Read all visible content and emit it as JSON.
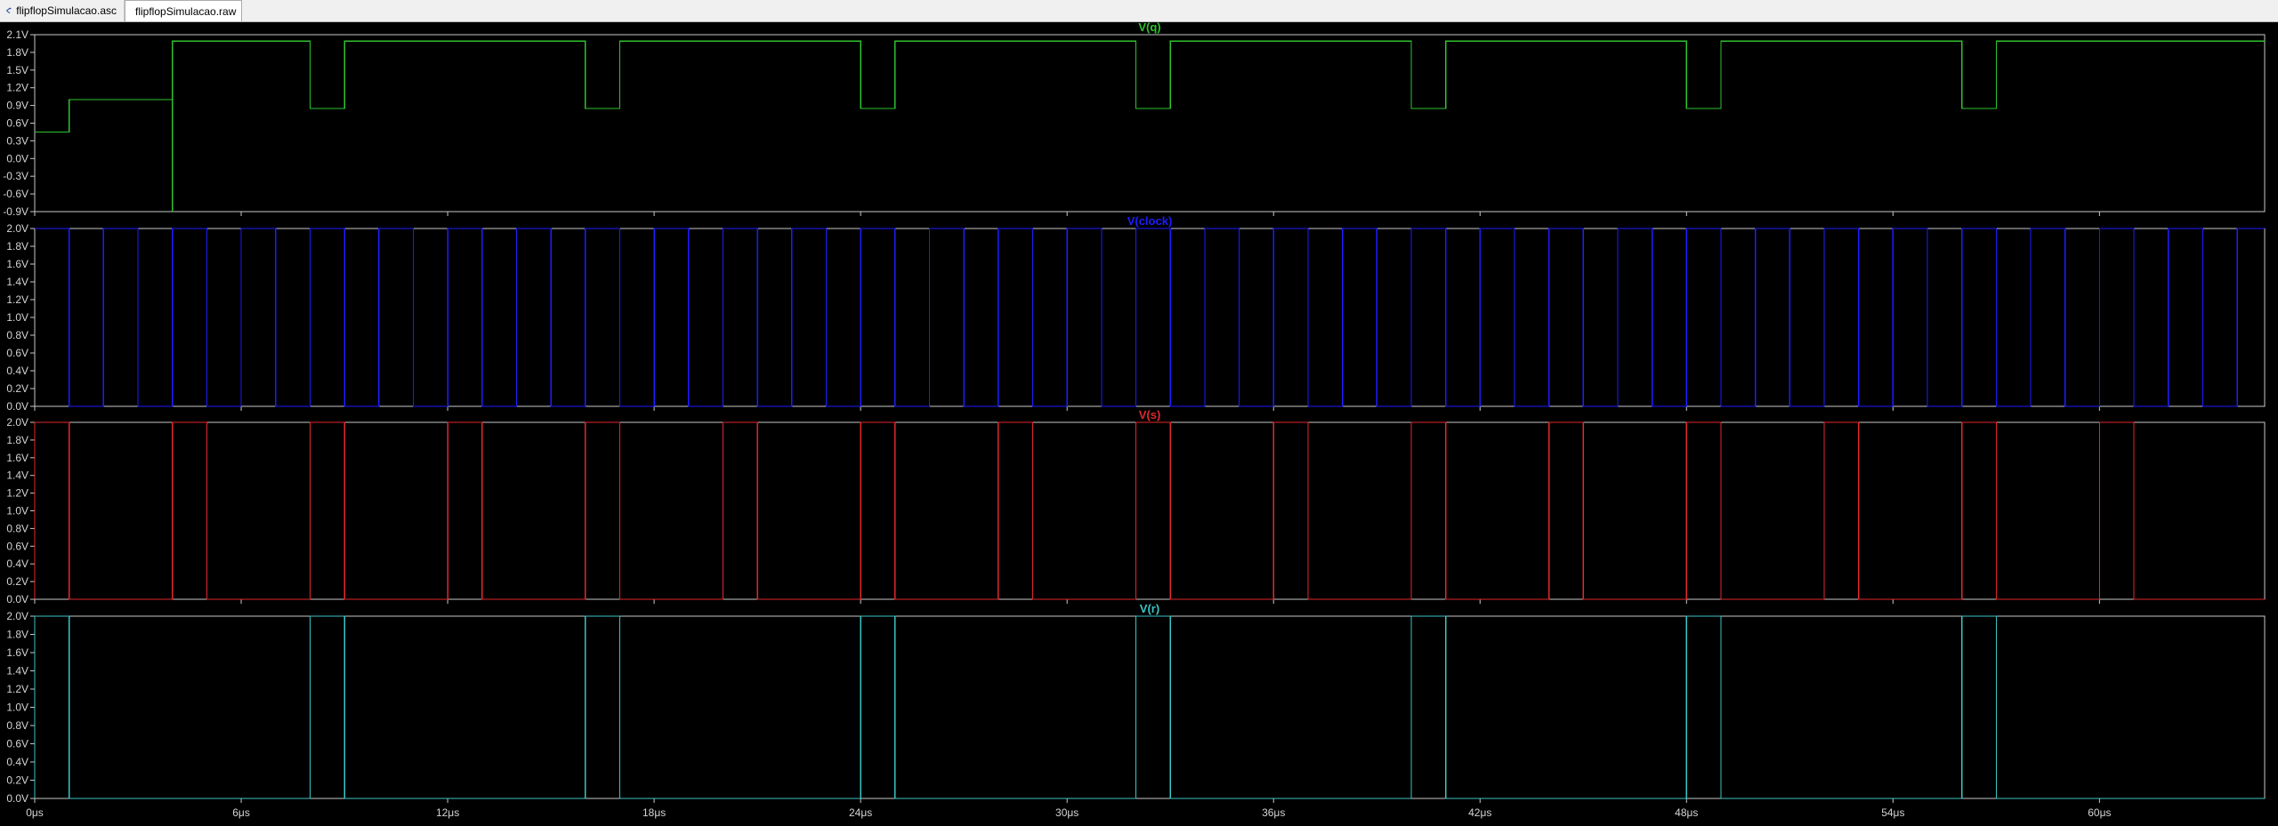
{
  "tabs": [
    {
      "label": "flipflopSimulacao.asc",
      "icon": "schematic-icon",
      "active": false
    },
    {
      "label": "flipflopSimulacao.raw",
      "icon": "waveform-icon",
      "active": true
    }
  ],
  "colors": {
    "background": "#000000",
    "frame": "#c8c8c8",
    "tick_text": "#d4d4d4"
  },
  "chart_data": [
    {
      "type": "line",
      "title": "V(q)",
      "color": "#2ec22e",
      "ylim": [
        -0.9,
        2.1
      ],
      "yticks": [
        "2.1V",
        "1.8V",
        "1.5V",
        "1.2V",
        "0.9V",
        "0.6V",
        "0.3V",
        "0.0V",
        "-0.3V",
        "-0.6V",
        "-0.9V"
      ],
      "grid": false,
      "series": [
        {
          "x_us": [
            0,
            1,
            1,
            4,
            4,
            4,
            8,
            8,
            9,
            9,
            16,
            16,
            17,
            17,
            24,
            24,
            25,
            25,
            32,
            32,
            33,
            33,
            40,
            40,
            41,
            41,
            48,
            48,
            49,
            49,
            56,
            56,
            57,
            57,
            64.8
          ],
          "y": [
            0.45,
            0.45,
            1.0,
            1.0,
            -0.9,
            1.99,
            1.99,
            0.85,
            0.85,
            1.99,
            1.99,
            0.85,
            0.85,
            1.99,
            1.99,
            0.85,
            0.85,
            1.99,
            1.99,
            0.85,
            0.85,
            1.99,
            1.99,
            0.85,
            0.85,
            1.99,
            1.99,
            0.85,
            0.85,
            1.99,
            1.99,
            0.85,
            0.85,
            1.99,
            1.99
          ]
        }
      ]
    },
    {
      "type": "line",
      "title": "V(clock)",
      "color": "#1d1dff",
      "ylim": [
        0,
        2.0
      ],
      "yticks": [
        "2.0V",
        "1.8V",
        "1.6V",
        "1.4V",
        "1.2V",
        "1.0V",
        "0.8V",
        "0.6V",
        "0.4V",
        "0.2V",
        "0.0V"
      ],
      "grid": false,
      "square_wave": {
        "period_us": 2,
        "high": 2.0,
        "low": 0.0,
        "starts_high": true
      }
    },
    {
      "type": "line",
      "title": "V(s)",
      "color": "#e0282d",
      "ylim": [
        0,
        2.0
      ],
      "yticks": [
        "2.0V",
        "1.8V",
        "1.6V",
        "1.4V",
        "1.2V",
        "1.0V",
        "0.8V",
        "0.6V",
        "0.4V",
        "0.2V",
        "0.0V"
      ],
      "grid": false,
      "series": [
        {
          "high_intervals_us": [
            [
              0,
              1
            ],
            [
              4,
              5
            ],
            [
              8,
              9
            ],
            [
              12,
              13
            ],
            [
              16,
              17
            ],
            [
              20,
              21
            ],
            [
              24,
              25
            ],
            [
              28,
              29
            ],
            [
              32,
              33
            ],
            [
              36,
              37
            ],
            [
              40,
              41
            ],
            [
              44,
              45
            ],
            [
              48,
              49
            ],
            [
              52,
              53
            ],
            [
              56,
              57
            ],
            [
              60,
              61
            ]
          ],
          "high": 2.0,
          "low": 0.0
        }
      ]
    },
    {
      "type": "line",
      "title": "V(r)",
      "color": "#3ac5c5",
      "ylim": [
        0,
        2.0
      ],
      "yticks": [
        "2.0V",
        "1.8V",
        "1.6V",
        "1.4V",
        "1.2V",
        "1.0V",
        "0.8V",
        "0.6V",
        "0.4V",
        "0.2V",
        "0.0V"
      ],
      "grid": false,
      "series": [
        {
          "high_intervals_us": [
            [
              0,
              1
            ],
            [
              8,
              9
            ],
            [
              16,
              17
            ],
            [
              24,
              25
            ],
            [
              32,
              33
            ],
            [
              40,
              41
            ],
            [
              48,
              49
            ],
            [
              56,
              57
            ]
          ],
          "high": 2.0,
          "low": 0.0
        }
      ]
    }
  ],
  "xaxis": {
    "xlim_us": [
      0,
      64.8
    ],
    "ticks_us": [
      0,
      6,
      12,
      18,
      24,
      30,
      36,
      42,
      48,
      54,
      60
    ],
    "tick_labels": [
      "0μs",
      "6μs",
      "12μs",
      "18μs",
      "24μs",
      "30μs",
      "36μs",
      "42μs",
      "48μs",
      "54μs",
      "60μs"
    ]
  }
}
